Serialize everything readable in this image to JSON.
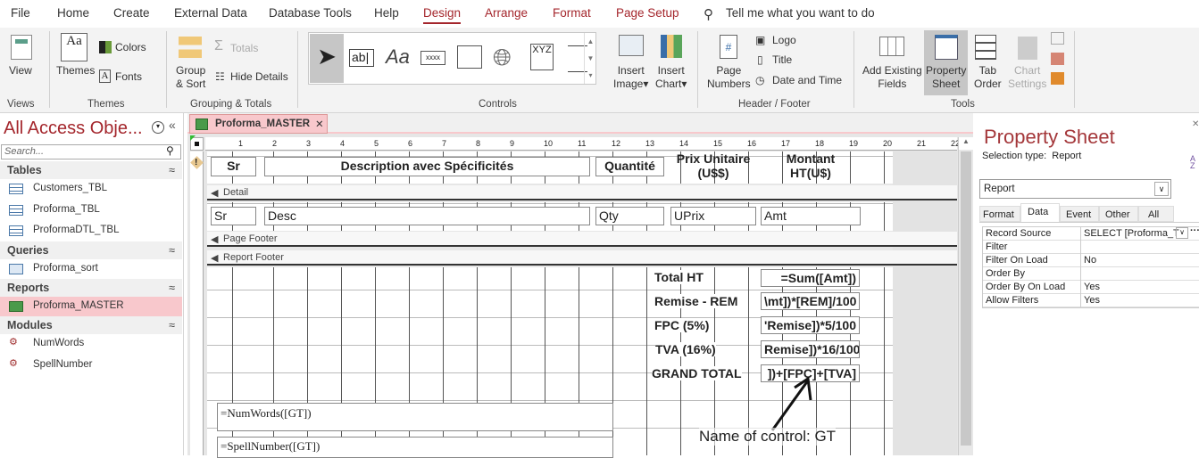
{
  "menu": {
    "tabs": [
      "File",
      "Home",
      "Create",
      "External Data",
      "Database Tools",
      "Help",
      "Design",
      "Arrange",
      "Format",
      "Page Setup"
    ],
    "search": "Tell me what you want to do"
  },
  "ribbon": {
    "views": {
      "view": "View",
      "label": "Views"
    },
    "themes": {
      "themes": "Themes",
      "colors": "Colors",
      "fonts": "Fonts",
      "label": "Themes"
    },
    "grouping": {
      "group_sort_1": "Group",
      "group_sort_2": "& Sort",
      "totals": "Totals",
      "hide_details": "Hide Details",
      "label": "Grouping & Totals"
    },
    "controls": {
      "label": "Controls",
      "textbox": "ab|",
      "label_ctl": "Aa",
      "button": "xxxx",
      "xyz": "XYZ"
    },
    "insert": {
      "image_1": "Insert",
      "image_2": "Image",
      "chart_1": "Insert",
      "chart_2": "Chart"
    },
    "header_footer": {
      "page_numbers_1": "Page",
      "page_numbers_2": "Numbers",
      "logo": "Logo",
      "title": "Title",
      "date_time": "Date and Time",
      "label": "Header / Footer"
    },
    "tools": {
      "add_fields_1": "Add Existing",
      "add_fields_2": "Fields",
      "property_sheet_1": "Property",
      "property_sheet_2": "Sheet",
      "tab_order_1": "Tab",
      "tab_order_2": "Order",
      "chart_settings_1": "Chart",
      "chart_settings_2": "Settings",
      "label": "Tools"
    }
  },
  "nav": {
    "title": "All Access Obje...",
    "search_placeholder": "Search...",
    "sections": [
      {
        "label": "Tables",
        "items": [
          "Customers_TBL",
          "Proforma_TBL",
          "ProformaDTL_TBL"
        ]
      },
      {
        "label": "Queries",
        "items": [
          "Proforma_sort"
        ]
      },
      {
        "label": "Reports",
        "items": [
          "Proforma_MASTER"
        ]
      },
      {
        "label": "Modules",
        "items": [
          "NumWords",
          "SpellNumber"
        ]
      }
    ]
  },
  "doc": {
    "tab": "Proforma_MASTER",
    "ruler": [
      "1",
      "2",
      "3",
      "4",
      "5",
      "6",
      "7",
      "8",
      "9",
      "10",
      "11",
      "12",
      "13",
      "14",
      "15",
      "16",
      "17",
      "18",
      "19",
      "20",
      "21",
      "22"
    ],
    "page_header": {
      "sr": "Sr",
      "desc": "Description avec Spécificités",
      "qty": "Quantité",
      "prix_1": "Prix Unitaire",
      "prix_2": "(U$$)",
      "montant_1": "Montant",
      "montant_2": "HT(U$)"
    },
    "bands": {
      "detail": "Detail",
      "page_footer": "Page Footer",
      "report_footer": "Report Footer"
    },
    "detail": {
      "sr": "Sr",
      "desc": "Desc",
      "qty": "Qty",
      "uprix": "UPrix",
      "amt": "Amt"
    },
    "footer": {
      "labels": [
        "Total HT",
        "Remise - REM",
        "FPC (5%)",
        "TVA (16%)",
        "GRAND TOTAL"
      ],
      "values": [
        "=Sum([Amt])",
        "\\mt])*[REM]/100",
        "'Remise])*5/100",
        "Remise])*16/100",
        "])+[FPC]+[TVA]"
      ],
      "numwords": "=NumWords([GT])",
      "spellnumber": "=SpellNumber([GT])"
    },
    "annotation": "Name of control: GT"
  },
  "property_sheet": {
    "title": "Property Sheet",
    "selection_type_label": "Selection type:",
    "selection_type": "Report",
    "selector": "Report",
    "tabs": [
      "Format",
      "Data",
      "Event",
      "Other",
      "All"
    ],
    "active_tab": "Data",
    "rows": [
      {
        "name": "Record Source",
        "value": "SELECT [Proforma_T"
      },
      {
        "name": "Filter",
        "value": ""
      },
      {
        "name": "Filter On Load",
        "value": "No"
      },
      {
        "name": "Order By",
        "value": ""
      },
      {
        "name": "Order By On Load",
        "value": "Yes"
      },
      {
        "name": "Allow Filters",
        "value": "Yes"
      }
    ]
  },
  "colors": {
    "accent": "#a4262c",
    "selected_nav": "#f8c8cc"
  }
}
